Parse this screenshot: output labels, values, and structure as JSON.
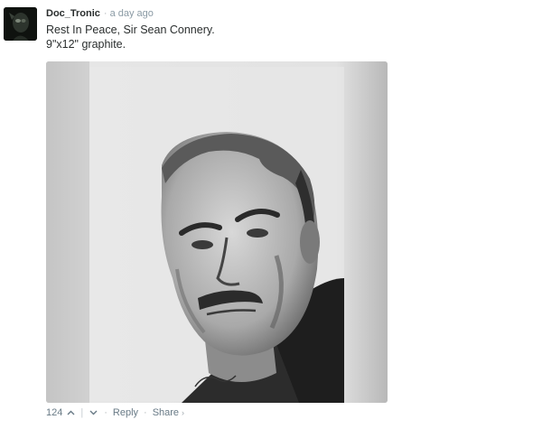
{
  "comment": {
    "author": "Doc_Tronic",
    "separator": "·",
    "timestamp": "a day ago",
    "lines": [
      "Rest In Peace, Sir Sean Connery.",
      "9\"x12\" graphite."
    ],
    "avatar_icon": "dark-portrait-avatar",
    "image_icon": "pencil-portrait-drawing"
  },
  "footer": {
    "vote_count": "124",
    "upvote_icon": "chevron-up-icon",
    "downvote_icon": "chevron-down-icon",
    "divider": "|",
    "bullet": "·",
    "reply_label": "Reply",
    "share_label": "Share",
    "share_arrow": "›"
  },
  "colors": {
    "author": "#2a2e2e",
    "meta": "#8a9aa4",
    "footer": "#687a86"
  }
}
